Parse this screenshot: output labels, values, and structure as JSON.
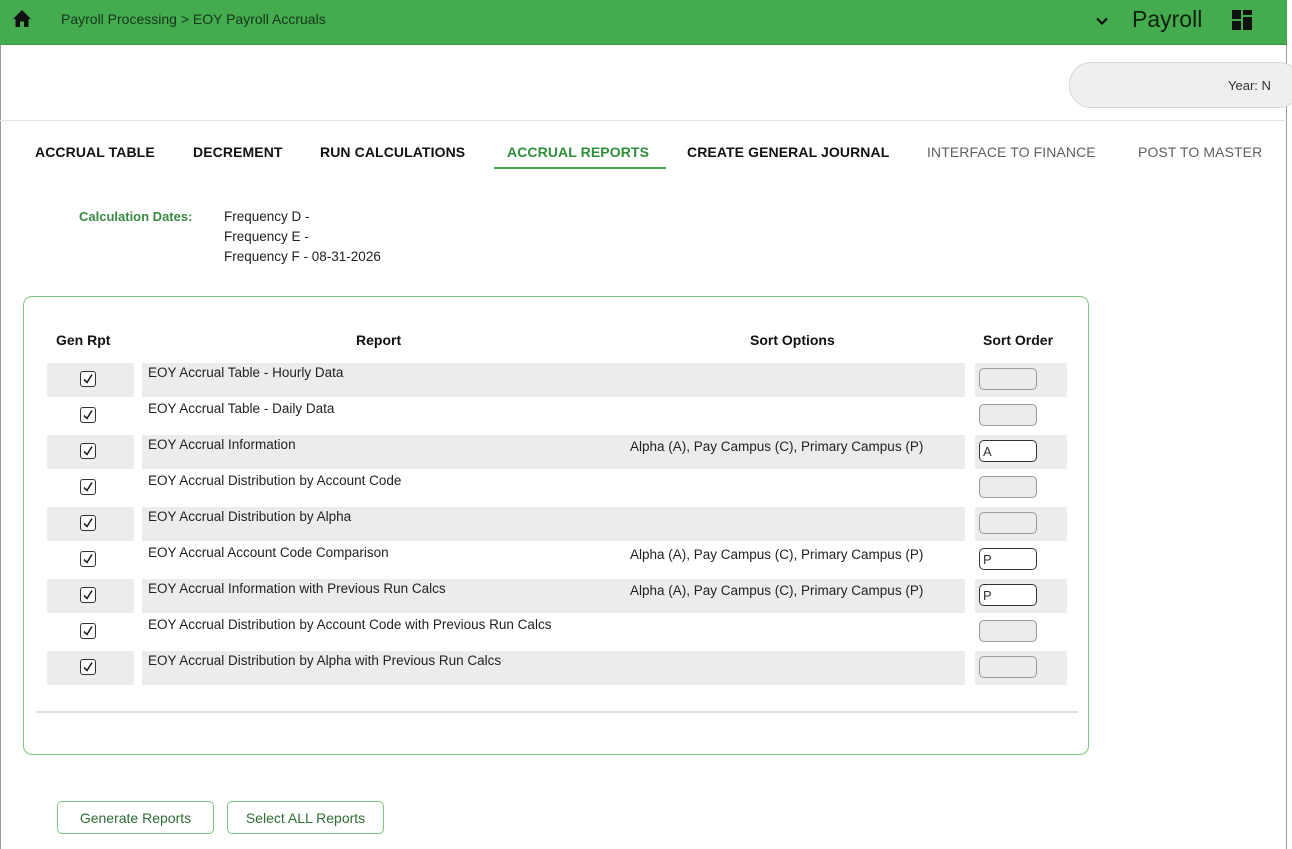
{
  "header": {
    "breadcrumb": "Payroll Processing > EOY Payroll Accruals",
    "app_name": "Payroll",
    "accent_color": "#44ac4e"
  },
  "year": {
    "label": "Year: N"
  },
  "tabs": [
    {
      "label": "ACCRUAL TABLE",
      "state": "normal"
    },
    {
      "label": "DECREMENT",
      "state": "normal"
    },
    {
      "label": "RUN CALCULATIONS",
      "state": "normal"
    },
    {
      "label": "ACCRUAL REPORTS",
      "state": "active"
    },
    {
      "label": "CREATE GENERAL JOURNAL",
      "state": "normal"
    },
    {
      "label": "INTERFACE TO FINANCE",
      "state": "disabled"
    },
    {
      "label": "POST TO MASTER",
      "state": "normal"
    }
  ],
  "calculation_dates": {
    "label": "Calculation Dates:",
    "lines": [
      "Frequency D -",
      "Frequency E -",
      "Frequency F - 08-31-2026"
    ]
  },
  "table": {
    "headers": {
      "gen_rpt": "Gen Rpt",
      "report": "Report",
      "sort_options": "Sort Options",
      "sort_order": "Sort Order"
    },
    "rows": [
      {
        "checked": true,
        "report": "EOY Accrual Table - Hourly Data",
        "sort_options": "",
        "sort_order": ""
      },
      {
        "checked": true,
        "report": "EOY Accrual Table - Daily Data",
        "sort_options": "",
        "sort_order": ""
      },
      {
        "checked": true,
        "report": "EOY Accrual Information",
        "sort_options": "Alpha (A), Pay Campus (C), Primary Campus (P)",
        "sort_order": "A"
      },
      {
        "checked": true,
        "report": "EOY Accrual Distribution by Account Code",
        "sort_options": "",
        "sort_order": ""
      },
      {
        "checked": true,
        "report": "EOY Accrual Distribution by Alpha",
        "sort_options": "",
        "sort_order": ""
      },
      {
        "checked": true,
        "report": "EOY Accrual Account Code Comparison",
        "sort_options": "Alpha (A), Pay Campus (C), Primary Campus (P)",
        "sort_order": "P"
      },
      {
        "checked": true,
        "report": "EOY Accrual Information with Previous Run Calcs",
        "sort_options": "Alpha (A), Pay Campus (C), Primary Campus (P)",
        "sort_order": "P"
      },
      {
        "checked": true,
        "report": "EOY Accrual Distribution by Account Code with Previous Run Calcs",
        "sort_options": "",
        "sort_order": ""
      },
      {
        "checked": true,
        "report": "EOY Accrual Distribution by Alpha with Previous Run Calcs",
        "sort_options": "",
        "sort_order": ""
      }
    ]
  },
  "buttons": {
    "generate": "Generate Reports",
    "select_all": "Select ALL Reports"
  }
}
